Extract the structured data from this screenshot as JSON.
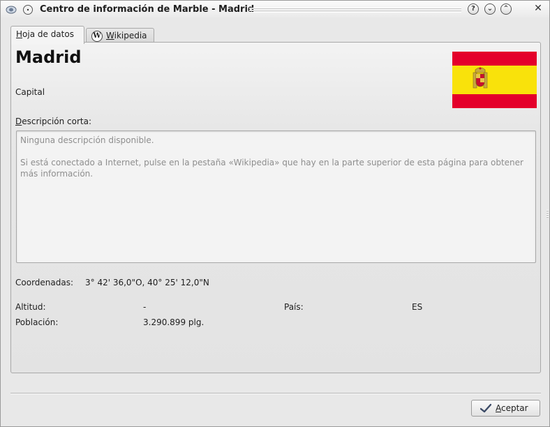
{
  "window": {
    "title": "Centro de información de Marble - Madrid",
    "buttons": {
      "help": "?",
      "minimize": "⌄",
      "maximize": "⌃",
      "close": "✕"
    },
    "icons": {
      "app": "marble-globe-icon",
      "sticky": "sticky-pin-icon"
    }
  },
  "tabs": [
    {
      "label_ul": "H",
      "label_rest": "oja de datos",
      "active": true
    },
    {
      "label_ul": "W",
      "label_rest": "ikipedia",
      "active": false,
      "icon": "wikipedia-icon"
    }
  ],
  "place": {
    "name": "Madrid",
    "role": "Capital",
    "flag": {
      "country": "ES",
      "colors": [
        "#e4002b",
        "#f9e20b",
        "#e4002b"
      ]
    }
  },
  "description": {
    "label_ul": "D",
    "label_rest": "escripción corta:",
    "line1": "Ninguna descripción disponible.",
    "line2": "Si está conectado a Internet, pulse en la pestaña «Wikipedia» que hay en la parte superior de esta página para obtener más información."
  },
  "details": {
    "coordinates_label": "Coordenadas:",
    "coordinates_value": "3° 42' 36,0\"O,  40° 25' 12,0\"N",
    "altitude_label": "Altitud:",
    "altitude_value": "-",
    "country_label": "País:",
    "country_value": "ES",
    "population_label": "Población:",
    "population_value": "3.290.899 plg."
  },
  "footer": {
    "accept_ul": "A",
    "accept_rest": "ceptar",
    "accept_icon": "checkmark-icon"
  }
}
